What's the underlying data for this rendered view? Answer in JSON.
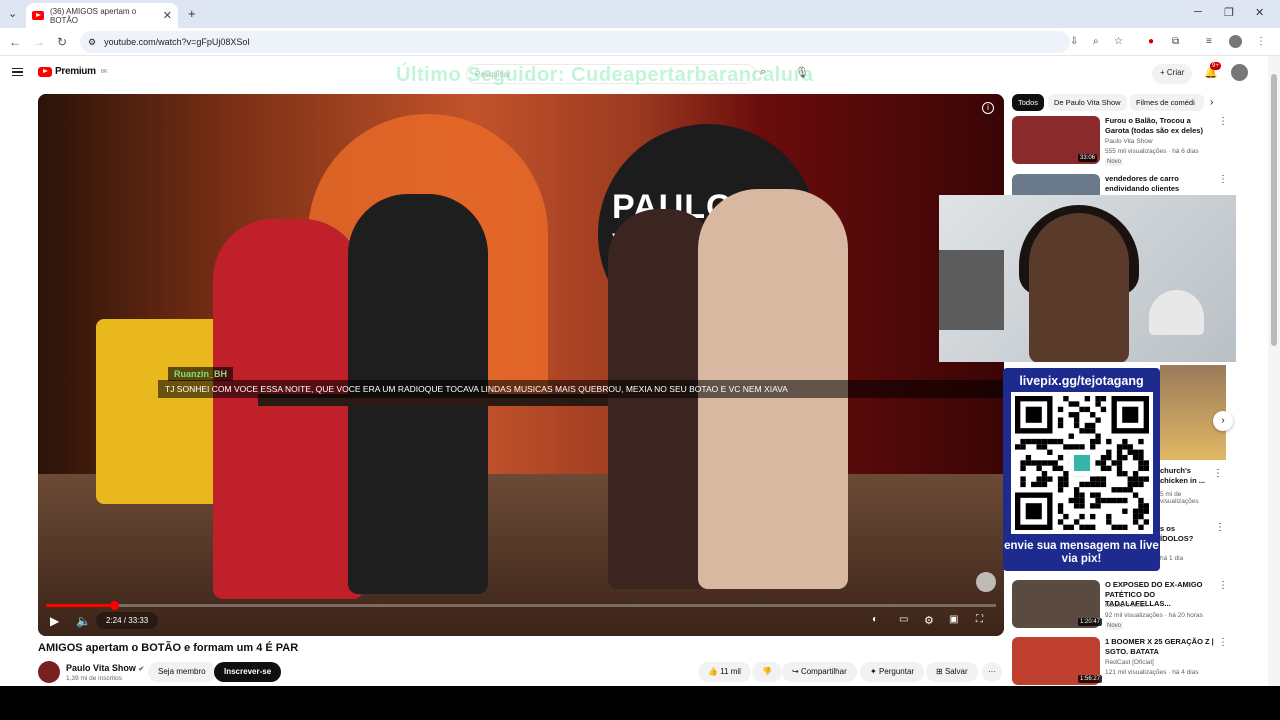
{
  "browser": {
    "tab_title": "(36) AMIGOS apertam o BOTÃO",
    "url": "youtube.com/watch?v=gFpUj08XSoI"
  },
  "youtube": {
    "logo_text": "Premium",
    "logo_sup": "BR",
    "overlay_text": "Último Seguidor: Cudeapertarbarancalura",
    "search_placeholder": "Pesquisar",
    "create_label": "+ Criar",
    "notif_count": "9+"
  },
  "player": {
    "chat_user": "Ruanzin_BH",
    "chat_message": "TJ SONHEI COM VOCE ESSA NOITE, QUE VOCE ERA UM RADIOQUE TOCAVA LINDAS MUSICAS MAIS QUEBROU, MEXIA NO SEU BOTAO E VC NEM XIAVA",
    "studio_sign": "PAULO VITASh",
    "time": "2:24 / 33:33",
    "progress": 0.072
  },
  "video": {
    "title": "AMIGOS apertam o BOTÃO e formam um 4 É PAR",
    "channel": "Paulo Vita Show",
    "subs": "1,39 mi de inscritos",
    "join_label": "Seja membro",
    "subscribe_label": "Inscrever-se",
    "likes": "11 mil",
    "share_label": "Compartilhar",
    "ask_label": "Perguntar",
    "save_label": "Salvar"
  },
  "chips": [
    "Todos",
    "De Paulo Vita Show",
    "Filmes de comédi"
  ],
  "recommendations": [
    {
      "title": "Furou o Balão, Trocou a Garota (todas são ex deles)",
      "channel": "Paulo Vita Show",
      "meta": "555 mil visualizações · há 6 dias",
      "badge": "Novo",
      "duration": "33:06",
      "color": "#8a2a2a"
    },
    {
      "title": "vendedores de carro endividando clientes",
      "channel": "",
      "meta": "",
      "badge": "",
      "duration": "",
      "color": "#6a7a8a"
    },
    {
      "title": "O EXPOSED DO EX-AMIGO PATÉTICO DO TADALAFELLAS...",
      "channel": "Neon2 e Neon",
      "meta": "92 mil visualizações · há 20 horas",
      "badge": "Novo",
      "duration": "1:20:47",
      "color": "#5a4a40"
    },
    {
      "title": "1 BOOMER X 25 GERAÇÃO Z | SGTO. BATATA",
      "channel": "RedCast [Oficial]",
      "meta": "121 mil visualizações · há 4 dias",
      "badge": "Novo",
      "duration": "1:56:27",
      "color": "#c04030"
    }
  ],
  "partial_recos": {
    "r1_title": "church's chicken in ...",
    "r1_meta": "5 mi de visualizações",
    "r2_title": "s os ÍDOLOS?",
    "r2_meta": "há 1 dia"
  },
  "pix": {
    "url": "livepix.gg/tejotagang",
    "message": "envie sua mensagem na live via pix!"
  }
}
